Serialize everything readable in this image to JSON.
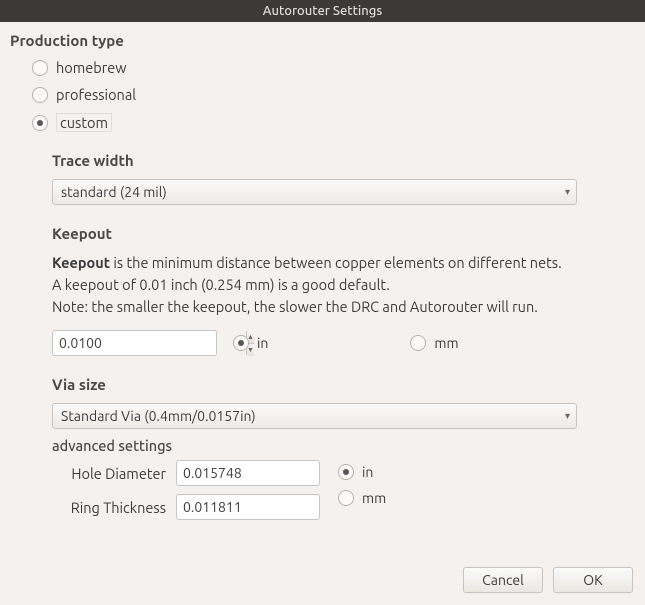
{
  "window": {
    "title": "Autorouter Settings"
  },
  "production": {
    "heading": "Production type",
    "options": {
      "homebrew": "homebrew",
      "professional": "professional",
      "custom": "custom"
    },
    "selected": "custom"
  },
  "trace_width": {
    "heading": "Trace width",
    "value": "standard (24 mil)"
  },
  "keepout": {
    "heading": "Keepout",
    "desc_bold": "Keepout",
    "desc_rest": " is the minimum distance between copper elements on different nets.",
    "desc_line2": "A keepout of 0.01 inch (0.254 mm) is a good default.",
    "desc_line3": "Note: the smaller the keepout, the slower the DRC and Autorouter will run.",
    "value": "0.0100",
    "units": {
      "in": "in",
      "mm": "mm",
      "selected": "in"
    }
  },
  "via": {
    "heading": "Via size",
    "value": "Standard Via (0.4mm/0.0157in)",
    "adv_heading": "advanced settings",
    "hole_label": "Hole Diameter",
    "hole_value": "0.015748",
    "ring_label": "Ring Thickness",
    "ring_value": "0.011811",
    "units": {
      "in": "in",
      "mm": "mm",
      "selected": "in"
    }
  },
  "buttons": {
    "cancel": "Cancel",
    "ok": "OK"
  }
}
